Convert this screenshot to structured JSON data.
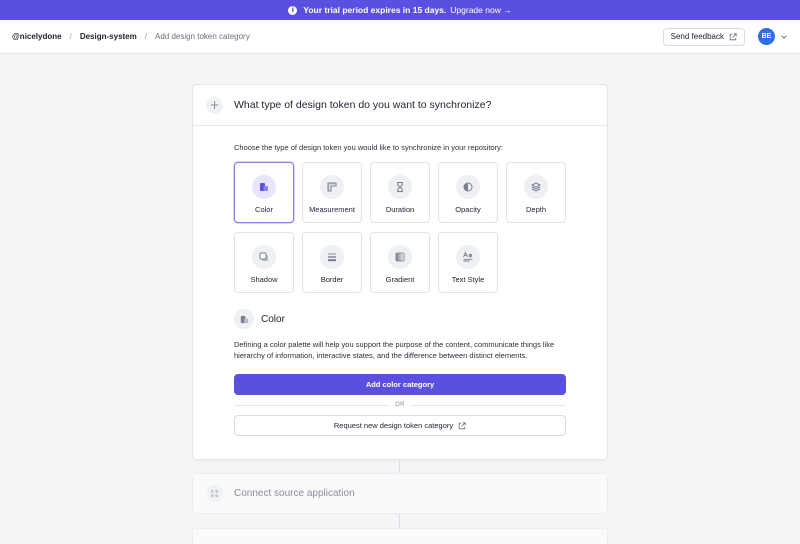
{
  "banner": {
    "message": "Your trial period expires in 15 days.",
    "upgrade_label": "Upgrade now →"
  },
  "breadcrumb": {
    "items": [
      "@nicelydone",
      "Design-system",
      "Add design token category"
    ],
    "separator": "/"
  },
  "header": {
    "feedback_label": "Send feedback",
    "avatar_initials": "BE"
  },
  "step1": {
    "title": "What type of design token do you want to synchronize?",
    "instruction": "Choose the type of design token you would like to synchronize in your repository:",
    "tiles": [
      {
        "label": "Color",
        "icon": "color-swatch-icon",
        "selected": true
      },
      {
        "label": "Measurement",
        "icon": "ruler-icon",
        "selected": false
      },
      {
        "label": "Duration",
        "icon": "hourglass-icon",
        "selected": false
      },
      {
        "label": "Opacity",
        "icon": "opacity-icon",
        "selected": false
      },
      {
        "label": "Depth",
        "icon": "layers-icon",
        "selected": false
      },
      {
        "label": "Shadow",
        "icon": "shadow-icon",
        "selected": false
      },
      {
        "label": "Border",
        "icon": "border-icon",
        "selected": false
      },
      {
        "label": "Gradient",
        "icon": "gradient-icon",
        "selected": false
      },
      {
        "label": "Text Style",
        "icon": "text-style-icon",
        "selected": false
      }
    ],
    "detail": {
      "title": "Color",
      "description": "Defining a color palette will help you support the purpose of the content, communicate things like hierarchy of information, interactive states, and the difference between distinct elements."
    },
    "primary_button": "Add color category",
    "or_label": "OR",
    "secondary_button": "Request new design token category"
  },
  "step2": {
    "title": "Connect source application"
  },
  "colors": {
    "accent": "#5b4fe0",
    "avatar": "#2f6fe0"
  }
}
